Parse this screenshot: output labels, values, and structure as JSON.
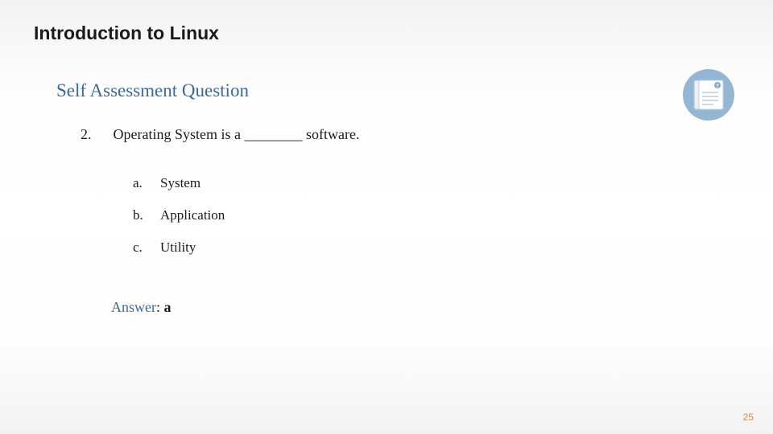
{
  "title": "Introduction to Linux",
  "section_heading": "Self Assessment Question",
  "question": {
    "number": "2.",
    "text": "Operating System is a ________ software."
  },
  "options": [
    {
      "letter": "a.",
      "text": "System"
    },
    {
      "letter": "b.",
      "text": "Application"
    },
    {
      "letter": "c.",
      "text": "Utility"
    }
  ],
  "answer": {
    "label": "Answer",
    "value": "a"
  },
  "page_number": "25",
  "icon": "quiz-document-icon"
}
